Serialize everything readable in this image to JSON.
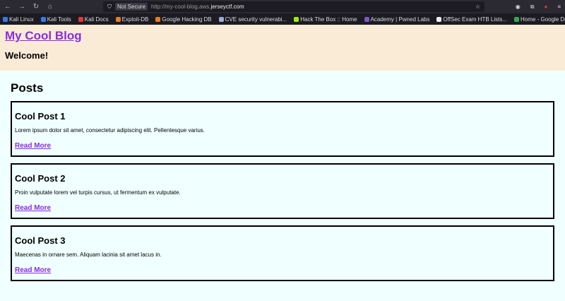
{
  "browser": {
    "security": "Not Secure",
    "url_prefix": "http://my-cool-blog.aws.",
    "url_domain": "jerseyctf.com",
    "bookmarks": [
      {
        "label": "Kali Linux",
        "color": "#367bf0"
      },
      {
        "label": "Kali Tools",
        "color": "#367bf0"
      },
      {
        "label": "Kali Docs",
        "color": "#e53935"
      },
      {
        "label": "Exploit-DB",
        "color": "#e67e22"
      },
      {
        "label": "Google Hacking DB",
        "color": "#e67e22"
      },
      {
        "label": "CVE security vulnerabi...",
        "color": "#9fa8da"
      },
      {
        "label": "Hack The Box :: Home",
        "color": "#9fef00"
      },
      {
        "label": "Academy | Pwned Labs",
        "color": "#7e57c2"
      },
      {
        "label": "OffSec Exam HTB Lists...",
        "color": "#eeeeee"
      },
      {
        "label": "Home - Google Drive",
        "color": "#34a853"
      }
    ]
  },
  "header": {
    "title": "My Cool Blog",
    "subtitle": "Welcome!"
  },
  "main": {
    "heading": "Posts",
    "posts": [
      {
        "title": "Cool Post 1",
        "body": "Lorem ipsum dolor sit amet, consectetur adipiscing elit. Pellentesque varius.",
        "link": "Read More"
      },
      {
        "title": "Cool Post 2",
        "body": "Proin vulputate lorem vel turpis cursus, ut fermentum ex vulputate.",
        "link": "Read More"
      },
      {
        "title": "Cool Post 3",
        "body": "Maecenas in ornare sem. Aliquam lacinia sit amet lacus in.",
        "link": "Read More"
      }
    ]
  },
  "colors": {
    "link": "#8a2be2",
    "header_bg": "#faebd7",
    "page_bg": "#f0ffff"
  }
}
